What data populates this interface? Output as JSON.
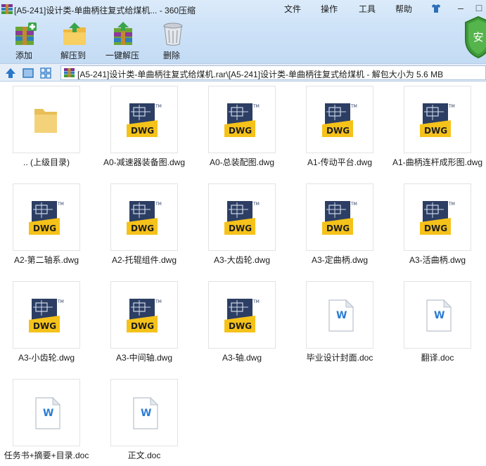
{
  "window": {
    "title": "[A5-241]设计类-单曲柄往复式给煤机... - 360压缩",
    "menu": [
      "文件",
      "操作",
      "工具",
      "帮助"
    ]
  },
  "toolbar": [
    {
      "label": "添加",
      "icon": "add-archive-icon"
    },
    {
      "label": "解压到",
      "icon": "extract-to-icon"
    },
    {
      "label": "一键解压",
      "icon": "one-click-extract-icon"
    },
    {
      "label": "删除",
      "icon": "trash-bin-icon"
    }
  ],
  "security_badge": "安",
  "address": {
    "path": "[A5-241]设计类-单曲柄往复式给煤机.rar\\[A5-241]设计类-单曲柄往复式给煤机 - 解包大小为 5.6 MB"
  },
  "files": [
    {
      "name": ".. (上级目录)",
      "type": "folder"
    },
    {
      "name": "A0-减速器装备图.dwg",
      "type": "dwg"
    },
    {
      "name": "A0-总装配图.dwg",
      "type": "dwg"
    },
    {
      "name": "A1-传动平台.dwg",
      "type": "dwg"
    },
    {
      "name": "A1-曲柄连杆成形图.dwg",
      "type": "dwg"
    },
    {
      "name": "A2-第二轴系.dwg",
      "type": "dwg"
    },
    {
      "name": "A2-托辊组件.dwg",
      "type": "dwg"
    },
    {
      "name": "A3-大齿轮.dwg",
      "type": "dwg"
    },
    {
      "name": "A3-定曲柄.dwg",
      "type": "dwg"
    },
    {
      "name": "A3-活曲柄.dwg",
      "type": "dwg"
    },
    {
      "name": "A3-小齿轮.dwg",
      "type": "dwg"
    },
    {
      "name": "A3-中间轴.dwg",
      "type": "dwg"
    },
    {
      "name": "A3-轴.dwg",
      "type": "dwg"
    },
    {
      "name": "毕业设计封面.doc",
      "type": "doc"
    },
    {
      "name": "翻译.doc",
      "type": "doc"
    },
    {
      "name": "任务书+摘要+目录.doc",
      "type": "doc"
    },
    {
      "name": "正文.doc",
      "type": "doc"
    }
  ],
  "icon_text": {
    "dwg": "DWG",
    "tm": "TM",
    "doc": "W"
  },
  "colors": {
    "dwg_yellow": "#f5c21a",
    "dwg_navy": "#2c3e63",
    "doc_blue": "#2b7cd3",
    "folder": "#f4d27a"
  }
}
